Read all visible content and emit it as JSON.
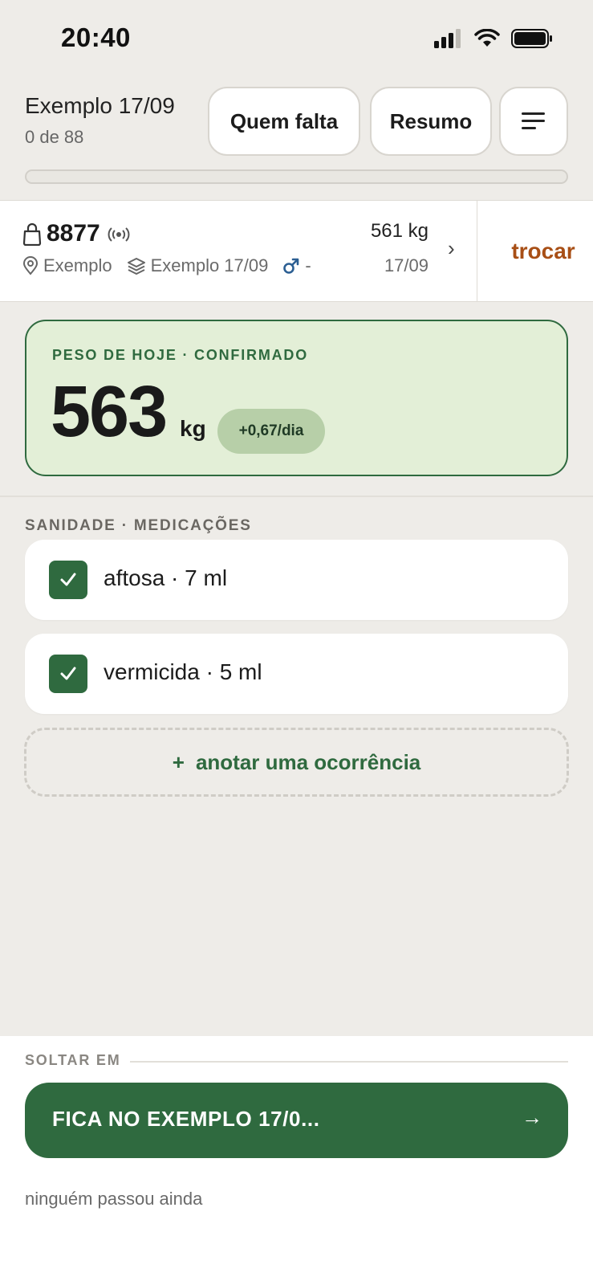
{
  "status_bar": {
    "time": "20:40"
  },
  "header": {
    "title": "Exemplo 17/09",
    "subtitle": "0 de 88",
    "btn_missing": "Quem falta",
    "btn_summary": "Resumo",
    "progress": 0
  },
  "animal": {
    "id": "8877",
    "location": "Exemplo",
    "batch": "Exemplo 17/09",
    "sex": "-",
    "last_weight": "561 kg",
    "last_date": "17/09",
    "chevron": "›",
    "swap_label": "trocar"
  },
  "weight_today": {
    "caption": "PESO DE HOJE · CONFIRMADO",
    "value": "563",
    "unit": "kg",
    "delta": "+0,67/dia"
  },
  "medications": {
    "title": "SANIDADE · MEDICAÇÕES",
    "items": [
      {
        "label": "aftosa · 7 ml",
        "checked": true
      },
      {
        "label": "vermicida · 5 ml",
        "checked": true
      }
    ],
    "add_label": "anotar uma ocorrência",
    "add_plus": "+"
  },
  "bottom": {
    "drop_label": "SOLTAR EM",
    "primary_label": "FICA NO EXEMPLO 17/0...",
    "primary_arrow": "→",
    "footer": "ninguém passou ainda"
  },
  "colors": {
    "brand_green": "#2f6a3f",
    "accent_orange": "#a84f16",
    "weight_bg": "#e3efd7",
    "page_bg": "#eeece8"
  },
  "icons": {
    "signal": "cellular-signal-icon",
    "wifi": "wifi-icon",
    "battery": "battery-icon",
    "menu": "hamburger-menu-icon",
    "tag": "ear-tag-icon",
    "rfid": "rfid-icon",
    "location": "location-pin-icon",
    "batch": "layers-icon",
    "sex": "male-icon"
  }
}
